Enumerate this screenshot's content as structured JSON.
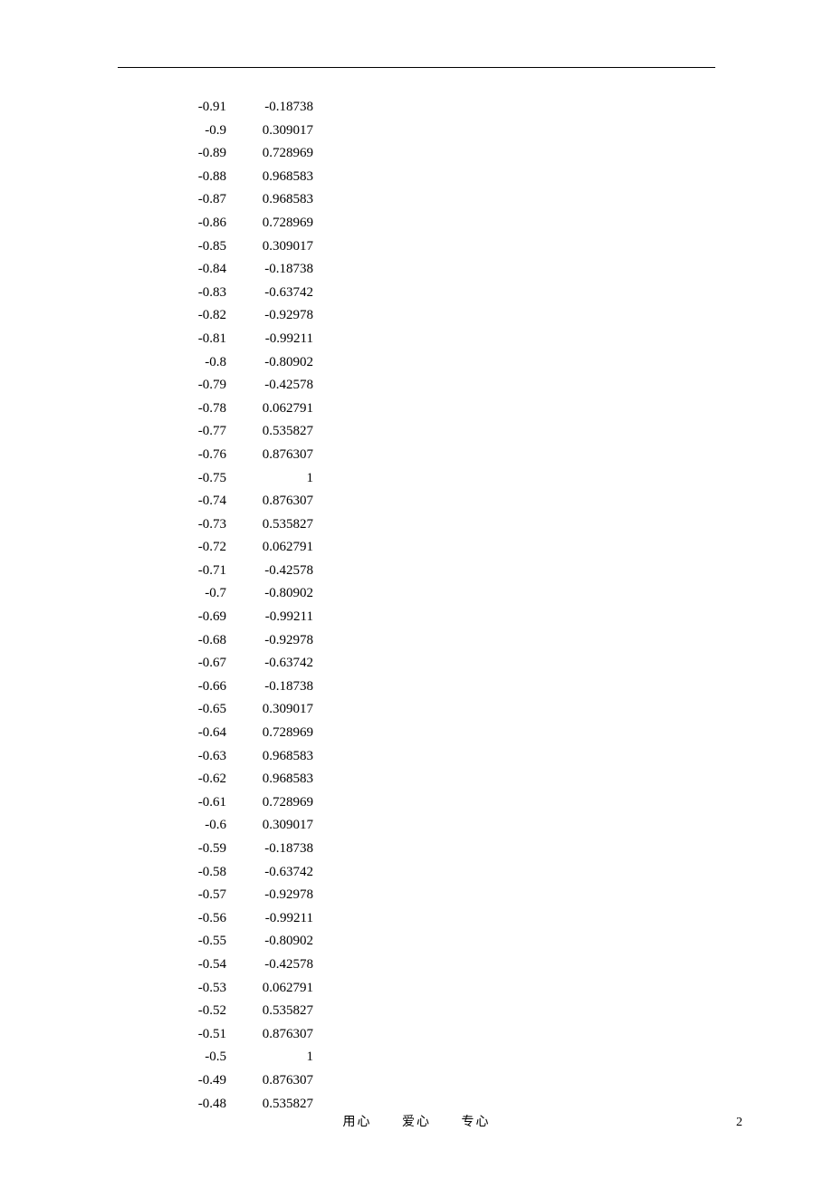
{
  "table": {
    "rows": [
      {
        "x": "-0.91",
        "y": "-0.18738"
      },
      {
        "x": "-0.9",
        "y": "0.309017"
      },
      {
        "x": "-0.89",
        "y": "0.728969"
      },
      {
        "x": "-0.88",
        "y": "0.968583"
      },
      {
        "x": "-0.87",
        "y": "0.968583"
      },
      {
        "x": "-0.86",
        "y": "0.728969"
      },
      {
        "x": "-0.85",
        "y": "0.309017"
      },
      {
        "x": "-0.84",
        "y": "-0.18738"
      },
      {
        "x": "-0.83",
        "y": "-0.63742"
      },
      {
        "x": "-0.82",
        "y": "-0.92978"
      },
      {
        "x": "-0.81",
        "y": "-0.99211"
      },
      {
        "x": "-0.8",
        "y": "-0.80902"
      },
      {
        "x": "-0.79",
        "y": "-0.42578"
      },
      {
        "x": "-0.78",
        "y": "0.062791"
      },
      {
        "x": "-0.77",
        "y": "0.535827"
      },
      {
        "x": "-0.76",
        "y": "0.876307"
      },
      {
        "x": "-0.75",
        "y": "1"
      },
      {
        "x": "-0.74",
        "y": "0.876307"
      },
      {
        "x": "-0.73",
        "y": "0.535827"
      },
      {
        "x": "-0.72",
        "y": "0.062791"
      },
      {
        "x": "-0.71",
        "y": "-0.42578"
      },
      {
        "x": "-0.7",
        "y": "-0.80902"
      },
      {
        "x": "-0.69",
        "y": "-0.99211"
      },
      {
        "x": "-0.68",
        "y": "-0.92978"
      },
      {
        "x": "-0.67",
        "y": "-0.63742"
      },
      {
        "x": "-0.66",
        "y": "-0.18738"
      },
      {
        "x": "-0.65",
        "y": "0.309017"
      },
      {
        "x": "-0.64",
        "y": "0.728969"
      },
      {
        "x": "-0.63",
        "y": "0.968583"
      },
      {
        "x": "-0.62",
        "y": "0.968583"
      },
      {
        "x": "-0.61",
        "y": "0.728969"
      },
      {
        "x": "-0.6",
        "y": "0.309017"
      },
      {
        "x": "-0.59",
        "y": "-0.18738"
      },
      {
        "x": "-0.58",
        "y": "-0.63742"
      },
      {
        "x": "-0.57",
        "y": "-0.92978"
      },
      {
        "x": "-0.56",
        "y": "-0.99211"
      },
      {
        "x": "-0.55",
        "y": "-0.80902"
      },
      {
        "x": "-0.54",
        "y": "-0.42578"
      },
      {
        "x": "-0.53",
        "y": "0.062791"
      },
      {
        "x": "-0.52",
        "y": "0.535827"
      },
      {
        "x": "-0.51",
        "y": "0.876307"
      },
      {
        "x": "-0.5",
        "y": "1"
      },
      {
        "x": "-0.49",
        "y": "0.876307"
      },
      {
        "x": "-0.48",
        "y": "0.535827"
      }
    ]
  },
  "footer": {
    "a": "用心",
    "b": "爱心",
    "c": "专心",
    "page": "2"
  }
}
